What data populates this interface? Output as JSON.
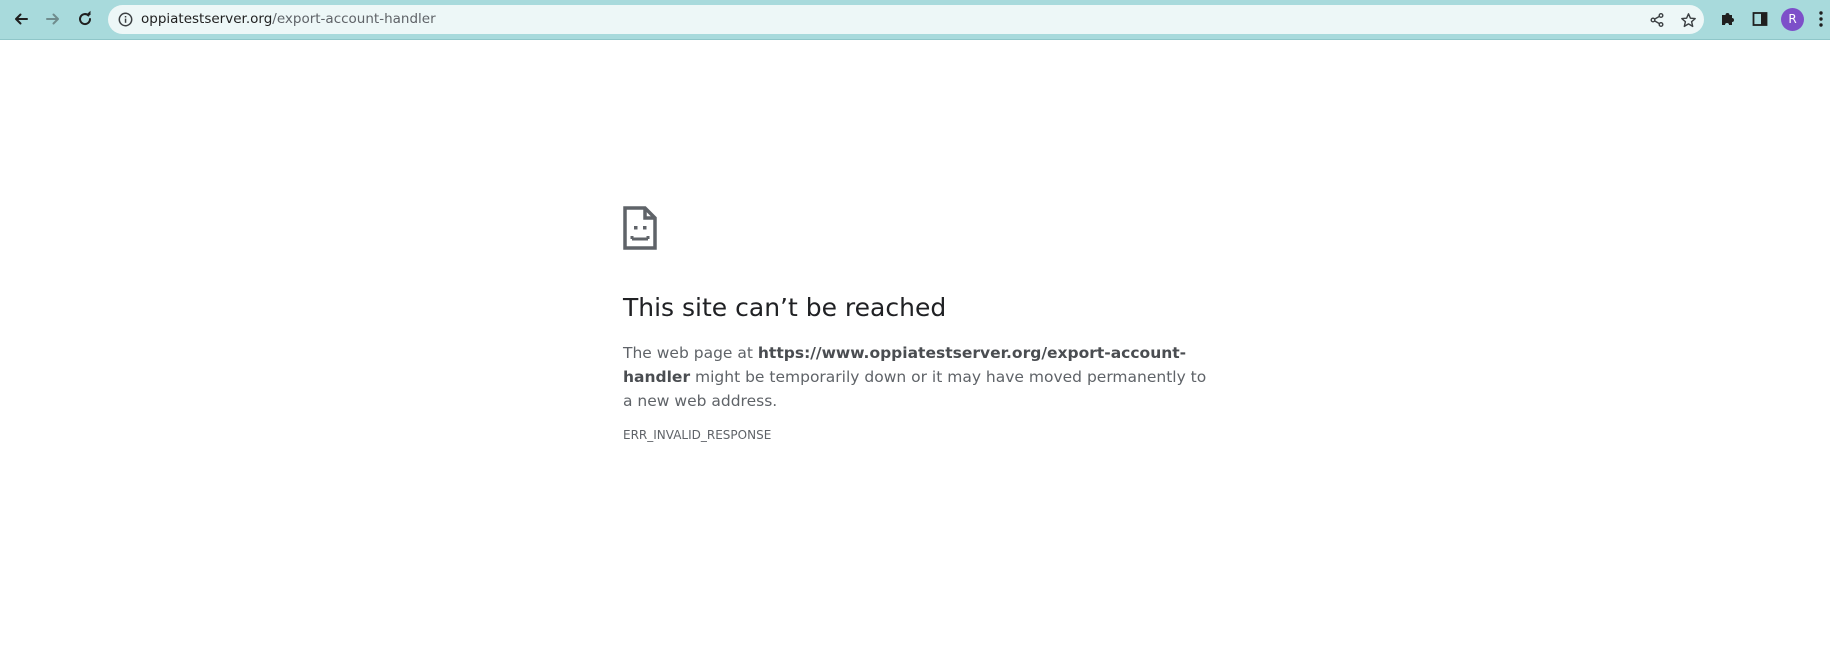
{
  "toolbar": {
    "back_icon": "arrow-left-icon",
    "forward_icon": "arrow-right-icon",
    "reload_icon": "reload-icon",
    "url_host": "oppiatestserver.org",
    "url_path": "/export-account-handler",
    "profile_initial": "R"
  },
  "error_page": {
    "icon": "sad-page-icon",
    "title": "This site can’t be reached",
    "desc_prefix": "The web page at ",
    "desc_url": "https://www.oppiatestserver.org/export-account-handler",
    "desc_suffix": " might be temporarily down or it may have moved permanently to a new web address.",
    "error_code": "ERR_INVALID_RESPONSE"
  },
  "colors": {
    "toolbar_bg": "#a8dadc",
    "omnibox_bg": "#edf7f7",
    "avatar_bg": "#7d4fc9"
  }
}
